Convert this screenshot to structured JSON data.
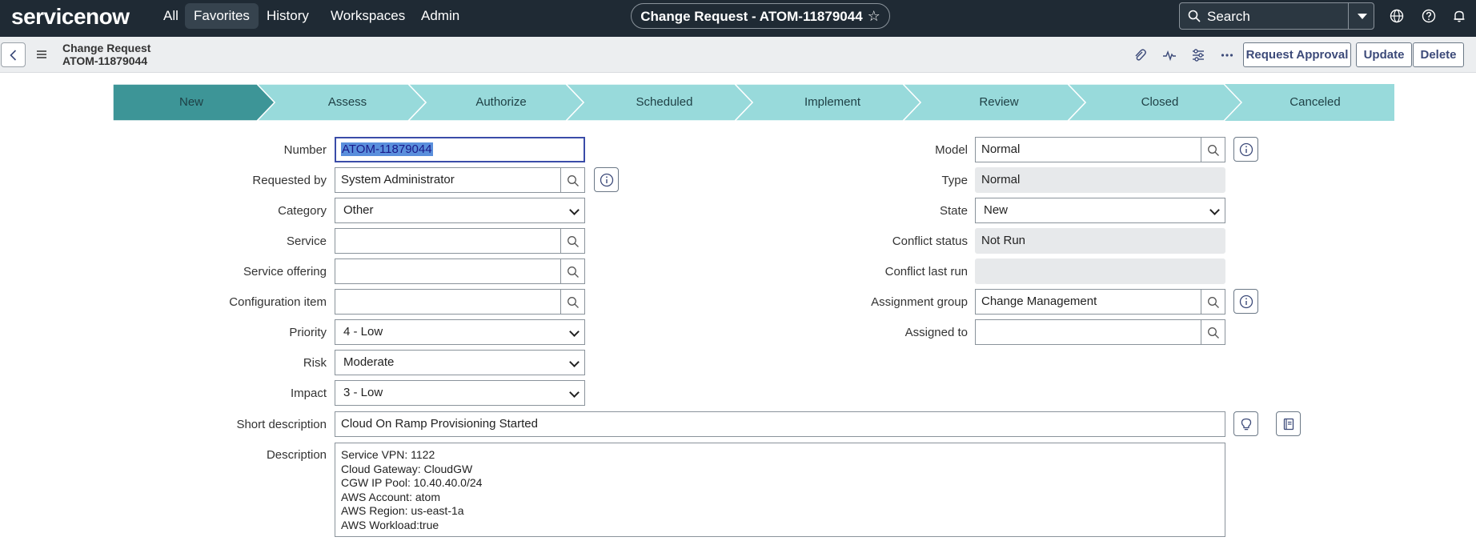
{
  "topnav": {
    "logo": "servicenow",
    "items": [
      "All",
      "Favorites",
      "History",
      "Workspaces",
      "Admin"
    ],
    "active_item": "Favorites",
    "record_title": "Change Request - ATOM-11879044",
    "search_placeholder": "Search",
    "icons": [
      "globe-icon",
      "help-icon",
      "bell-icon"
    ]
  },
  "header": {
    "record_type": "Change Request",
    "record_number": "ATOM-11879044",
    "icons": [
      "paperclip-icon",
      "activity-icon",
      "settings-sliders-icon",
      "more-icon"
    ],
    "buttons": {
      "request_approval": "Request Approval",
      "update": "Update",
      "delete": "Delete"
    }
  },
  "process_flow": {
    "stages": [
      "New",
      "Assess",
      "Authorize",
      "Scheduled",
      "Implement",
      "Review",
      "Closed",
      "Canceled"
    ],
    "current": "New",
    "colors": {
      "active": "#3d9597",
      "inactive": "#98dadb"
    }
  },
  "form": {
    "left": {
      "number": {
        "label": "Number",
        "value": "ATOM-11879044"
      },
      "requested_by": {
        "label": "Requested by",
        "value": "System Administrator"
      },
      "category": {
        "label": "Category",
        "value": "Other"
      },
      "service": {
        "label": "Service",
        "value": ""
      },
      "service_offering": {
        "label": "Service offering",
        "value": ""
      },
      "configuration_item": {
        "label": "Configuration item",
        "value": ""
      },
      "priority": {
        "label": "Priority",
        "value": "4 - Low"
      },
      "risk": {
        "label": "Risk",
        "value": "Moderate"
      },
      "impact": {
        "label": "Impact",
        "value": "3 - Low"
      }
    },
    "right": {
      "model": {
        "label": "Model",
        "value": "Normal"
      },
      "type": {
        "label": "Type",
        "value": "Normal"
      },
      "state": {
        "label": "State",
        "value": "New"
      },
      "conflict_status": {
        "label": "Conflict status",
        "value": "Not Run"
      },
      "conflict_last_run": {
        "label": "Conflict last run",
        "value": ""
      },
      "assignment_group": {
        "label": "Assignment group",
        "value": "Change Management"
      },
      "assigned_to": {
        "label": "Assigned to",
        "value": ""
      }
    },
    "short_description": {
      "label": "Short description",
      "value": "Cloud On Ramp  Provisioning Started"
    },
    "description": {
      "label": "Description",
      "lines": [
        "Service VPN: 1122",
        "Cloud Gateway: CloudGW",
        "CGW IP Pool: 10.40.40.0/24",
        "AWS Account: atom",
        "AWS Region: us-east-1a",
        "AWS Workload:true"
      ]
    }
  }
}
